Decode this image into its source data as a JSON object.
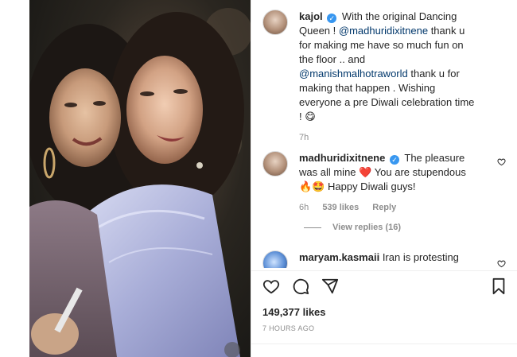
{
  "post": {
    "media_alt": "",
    "caption": {
      "username": "kajol",
      "line1": "With the original Dancing",
      "line2": "Queen ! ",
      "mention1": "@madhuridixitnene",
      "line2b": " thank u",
      "line3": "for making me have so much fun on",
      "line4": "the floor .. and",
      "mention2": "@manishmalhotraworld",
      "line5b": " thank u for",
      "line6": "making that happen . Wishing",
      "line7": "everyone a pre Diwali celebration time",
      "line8": "! 😋",
      "time": "7h"
    },
    "comments": [
      {
        "username": "madhuridixitnene",
        "line1": "The pleasure",
        "line2": "was all mine ❤️ You are stupendous",
        "line3": "🔥🤩 Happy Diwali guys!",
        "time": "6h",
        "likes": "539 likes",
        "reply": "Reply",
        "view_replies": "View replies (16)"
      },
      {
        "username": "maryam.kasmaii",
        "text": "Iran is protesting"
      }
    ],
    "likes_count": "149,377 likes",
    "posted": "7 HOURS AGO"
  },
  "colors": {
    "text": "#262626",
    "muted": "#8e8e8e",
    "link": "#00376b",
    "verified": "#3897f0"
  },
  "icons": [
    "heart-icon",
    "comment-icon",
    "share-icon",
    "bookmark-icon",
    "verified-icon",
    "like-comment-icon"
  ]
}
